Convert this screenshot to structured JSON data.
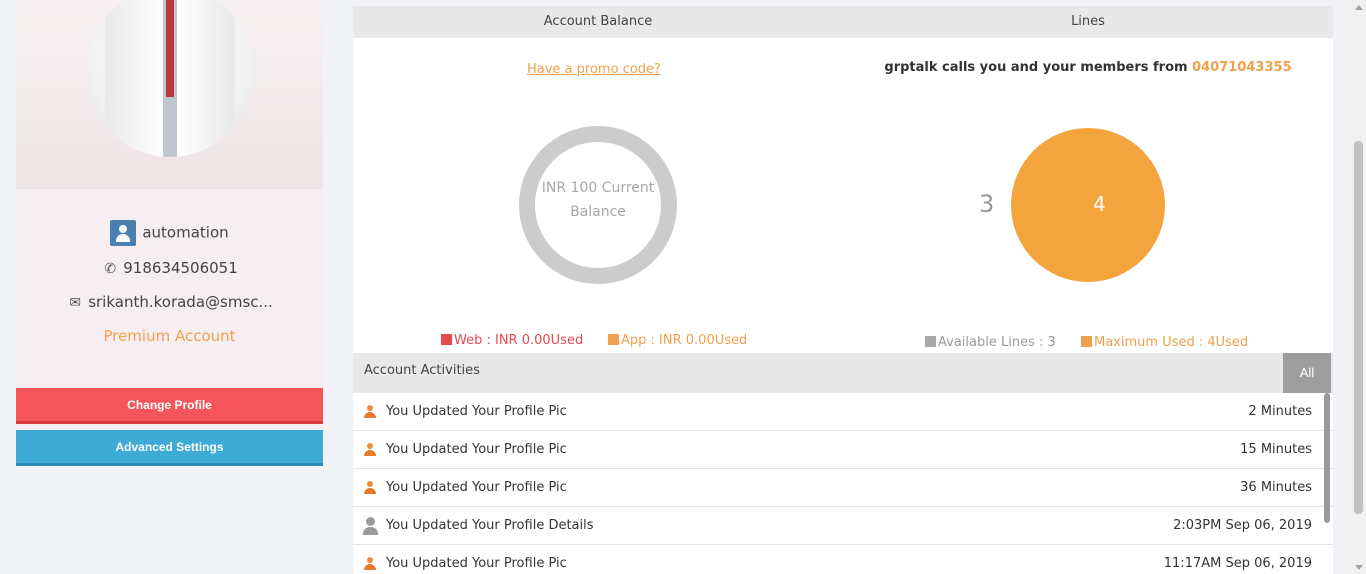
{
  "profile": {
    "username": "automation",
    "phone": "918634506051",
    "email": "srikanth.korada@smsc...",
    "account_type": "Premium Account",
    "change_profile_label": "Change Profile",
    "advanced_settings_label": "Advanced Settings"
  },
  "balance": {
    "header": "Account Balance",
    "promo_label": "Have a promo code?",
    "ring_text_line1": "INR 100 Current",
    "ring_text_line2": "Balance",
    "legend": [
      {
        "label": "Web : INR 0.00Used",
        "color": "#e84a50"
      },
      {
        "label": "App : INR 0.00Used",
        "color": "#f0a04b"
      }
    ]
  },
  "lines": {
    "header": "Lines",
    "title_prefix": "grptalk calls you and your members from",
    "number": "04071043355",
    "available_value": "3",
    "used_value": "4",
    "legend": [
      {
        "label": "Available Lines : 3",
        "color": "#aaaaaa"
      },
      {
        "label": "Maximum Used : 4Used",
        "color": "#f0a04b"
      }
    ]
  },
  "activities": {
    "title": "Account Activities",
    "filter_label": "All",
    "items": [
      {
        "icon": "profile-pic-icon",
        "text": "You Updated Your Profile Pic",
        "time": "2 Minutes"
      },
      {
        "icon": "profile-pic-icon",
        "text": "You Updated Your Profile Pic",
        "time": "15 Minutes"
      },
      {
        "icon": "profile-pic-icon",
        "text": "You Updated Your Profile Pic",
        "time": "36 Minutes"
      },
      {
        "icon": "profile-details-icon",
        "text": "You Updated Your Profile Details",
        "time": "2:03PM Sep 06, 2019"
      },
      {
        "icon": "profile-pic-icon",
        "text": "You Updated Your Profile Pic",
        "time": "11:17AM Sep 06, 2019"
      }
    ]
  },
  "colors": {
    "accent_orange": "#f0a04b",
    "change_profile_bg": "#f4555a",
    "advanced_settings_bg": "#3eaad6"
  }
}
